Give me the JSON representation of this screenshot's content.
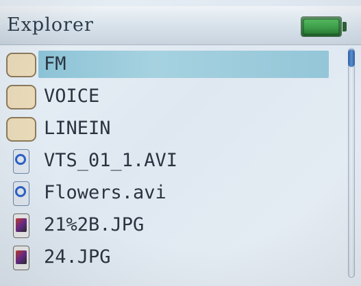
{
  "titlebar": {
    "title": "Explorer",
    "battery": {
      "level": 1.0,
      "color": "#3c9b48"
    }
  },
  "list": {
    "items": [
      {
        "label": "FM",
        "icon": "folder-icon",
        "selected": true
      },
      {
        "label": "VOICE",
        "icon": "folder-icon",
        "selected": false
      },
      {
        "label": "LINEIN",
        "icon": "folder-icon",
        "selected": false
      },
      {
        "label": "VTS_01_1.AVI",
        "icon": "video-file-icon",
        "selected": false
      },
      {
        "label": "Flowers.avi",
        "icon": "video-file-icon",
        "selected": false
      },
      {
        "label": "21%2B.JPG",
        "icon": "image-file-icon",
        "selected": false
      },
      {
        "label": "24.JPG",
        "icon": "image-file-icon",
        "selected": false
      }
    ]
  },
  "colors": {
    "highlight": "#a6d2e0",
    "scroll_thumb": "#4a7fc4"
  }
}
